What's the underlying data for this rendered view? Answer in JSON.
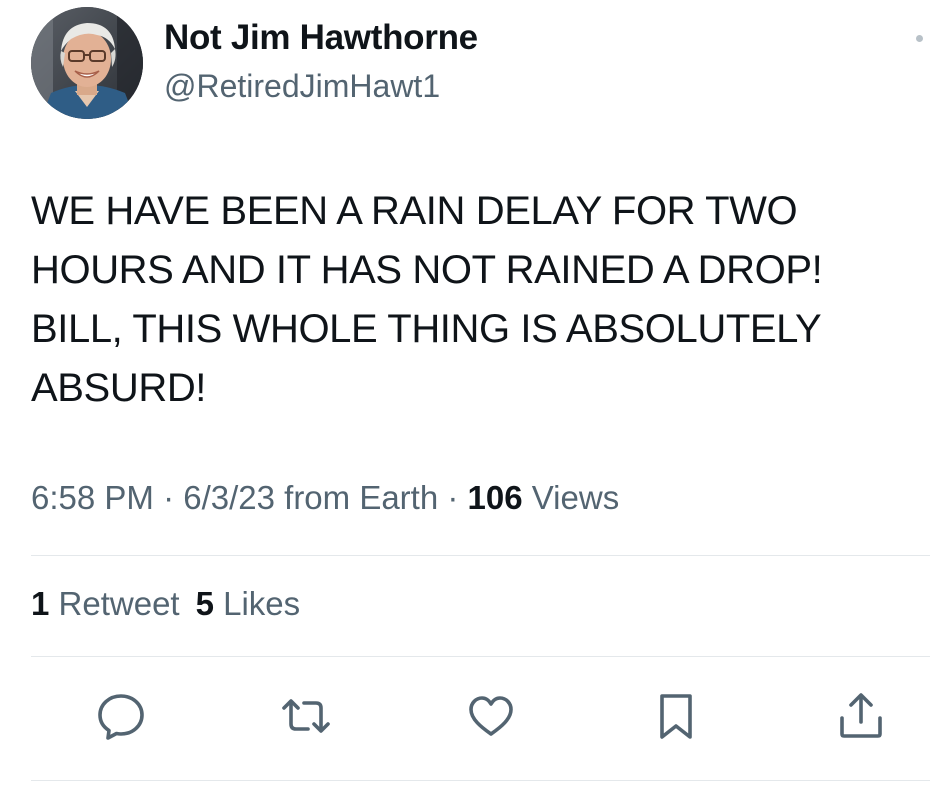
{
  "tweet": {
    "author": {
      "display_name": "Not Jim Hawthorne",
      "handle": "@RetiredJimHawt1"
    },
    "text": "WE HAVE BEEN A RAIN DELAY FOR TWO\nHOURS AND IT HAS NOT RAINED A DROP!\nBILL, THIS WHOLE THING IS ABSOLUTELY\nABSURD!",
    "meta": {
      "time": "6:58 PM",
      "sep1": " · ",
      "date": "6/3/23",
      "source": " from Earth",
      "sep2": " · ",
      "views_count": "106",
      "views_label": " Views"
    },
    "stats": {
      "retweets_count": "1",
      "retweets_label": " Retweet",
      "likes_count": "5",
      "likes_label": " Likes"
    }
  },
  "icons": {
    "reply": "reply-icon",
    "retweet": "retweet-icon",
    "like": "heart-icon",
    "bookmark": "bookmark-icon",
    "share": "share-icon",
    "more": "more-icon"
  },
  "colors": {
    "text_primary": "#0f1419",
    "text_secondary": "#536471",
    "divider": "#e4e8eb",
    "icon": "#536471"
  }
}
